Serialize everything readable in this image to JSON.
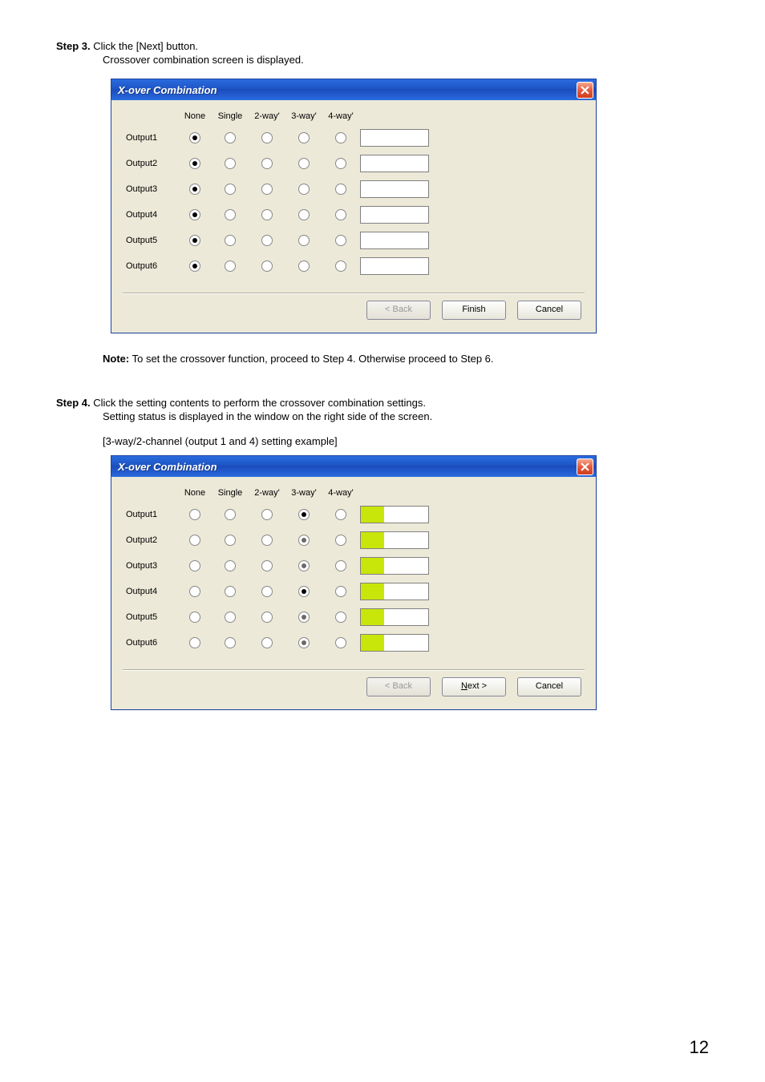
{
  "step3": {
    "label": "Step 3.",
    "line1": "Click the [Next] button.",
    "line2": "Crossover combination screen is displayed."
  },
  "dialog1": {
    "title": "X-over Combination",
    "headers": [
      "None",
      "Single",
      "2-way'",
      "3-way'",
      "4-way'"
    ],
    "rows": [
      {
        "label": "Output1",
        "selected": 0
      },
      {
        "label": "Output2",
        "selected": 0
      },
      {
        "label": "Output3",
        "selected": 0
      },
      {
        "label": "Output4",
        "selected": 0
      },
      {
        "label": "Output5",
        "selected": 0
      },
      {
        "label": "Output6",
        "selected": 0
      }
    ],
    "buttons": {
      "back": "< Back",
      "finish": "Finish",
      "cancel": "Cancel"
    }
  },
  "note": {
    "label": "Note:",
    "text": "To set the crossover function, proceed to  Step 4.   Otherwise proceed to Step 6."
  },
  "step4": {
    "label": "Step 4.",
    "line1": "Click the setting contents to perform the crossover combination settings.",
    "line2": "Setting status is displayed in the window on the right side of the screen.",
    "example": "[3-way/2-channel (output 1 and 4) setting example]"
  },
  "dialog2": {
    "title": "X-over Combination",
    "headers": [
      "None",
      "Single",
      "2-way'",
      "3-way'",
      "4-way'"
    ],
    "rows": [
      {
        "label": "Output1",
        "selected": 3,
        "dim": false
      },
      {
        "label": "Output2",
        "selected": 3,
        "dim": true
      },
      {
        "label": "Output3",
        "selected": 3,
        "dim": true
      },
      {
        "label": "Output4",
        "selected": 3,
        "dim": false
      },
      {
        "label": "Output5",
        "selected": 3,
        "dim": true
      },
      {
        "label": "Output6",
        "selected": 3,
        "dim": true
      }
    ],
    "preview_groups": [
      [
        1,
        1,
        1
      ],
      [
        1,
        1,
        1
      ]
    ],
    "buttons": {
      "back": "< Back",
      "next_pre": "N",
      "next_post": "ext >",
      "cancel": "Cancel"
    }
  },
  "page_number": "12"
}
